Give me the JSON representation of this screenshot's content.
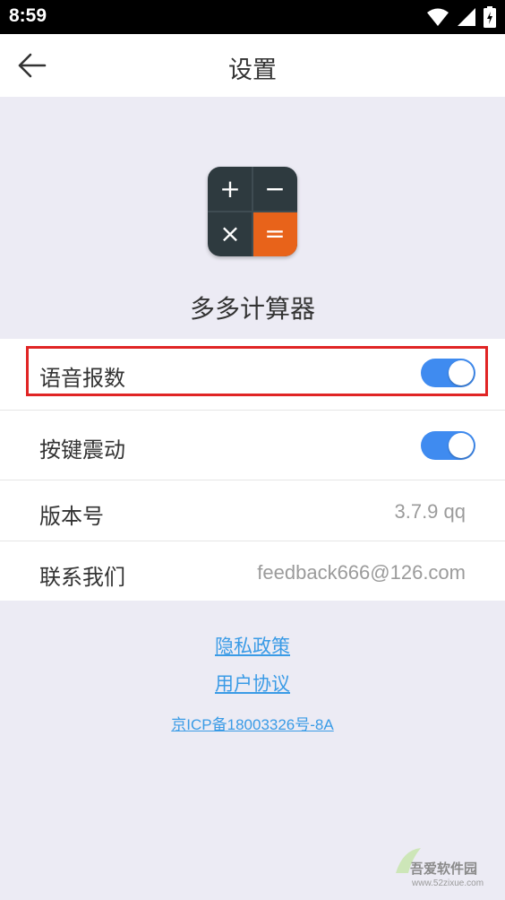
{
  "status_bar": {
    "time": "8:59"
  },
  "app_bar": {
    "title": "设置"
  },
  "app": {
    "name": "多多计算器",
    "icon_symbols": [
      "+",
      "−",
      "×",
      "="
    ]
  },
  "settings": {
    "voice_label": "语音报数",
    "voice_enabled": true,
    "vibrate_label": "按键震动",
    "vibrate_enabled": true,
    "version_label": "版本号",
    "version_value": "3.7.9  qq",
    "contact_label": "联系我们",
    "contact_value": "feedback666@126.com"
  },
  "links": {
    "privacy": "隐私政策",
    "agreement": "用户协议",
    "icp": "京ICP备18003326号-8A"
  },
  "watermark": {
    "title": "吾爱软件园",
    "url": "www.52zixue.com"
  },
  "colors": {
    "accent": "#3F8BF0",
    "link": "#3A9BE6",
    "highlight": "#E02424",
    "icon_dark": "#2E3A3F",
    "icon_orange": "#E8631A",
    "background": "#ECEBF4"
  }
}
